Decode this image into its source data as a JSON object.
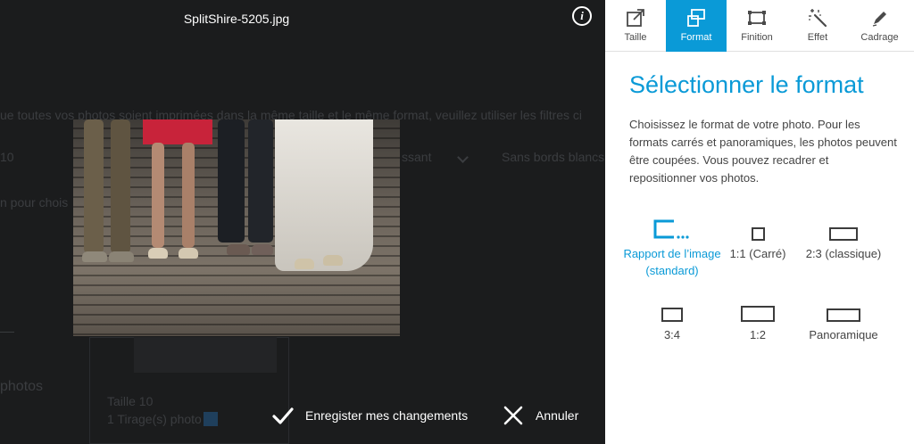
{
  "viewer": {
    "file_name": "SplitShire-5205.jpg",
    "info_label": "i"
  },
  "background": {
    "line1": "ue toutes vos photos soient imprimées dans la même taille et le même format, veuillez utiliser les filtres ci",
    "size_short": "10",
    "select_text": "ssant",
    "border_text": "Sans bords blancs",
    "hint": "n pour chois",
    "section": "photos",
    "card_size": "Taille 10",
    "card_count": "1 Tirage(s) photo"
  },
  "actions": {
    "save_label": "Enregister mes changements",
    "cancel_label": "Annuler"
  },
  "tabs": [
    {
      "label": "Taille",
      "icon": "resize-icon"
    },
    {
      "label": "Format",
      "icon": "format-icon"
    },
    {
      "label": "Finition",
      "icon": "frame-icon"
    },
    {
      "label": "Effet",
      "icon": "magic-wand-icon"
    },
    {
      "label": "Cadrage",
      "icon": "pen-icon"
    }
  ],
  "active_tab": "Format",
  "panel": {
    "title": "Sélectionner le format",
    "description": "Choisissez le format de votre photo. Pour les formats carrés et panoramiques, les photos peuvent être coupées. Vous pouvez recadrer et repositionner vos photos."
  },
  "formats": [
    {
      "label": "Rapport de l’image (standard)",
      "selected": true
    },
    {
      "label": "1:1 (Carré)",
      "selected": false
    },
    {
      "label": "2:3 (classique)",
      "selected": false
    },
    {
      "label": "3:4",
      "selected": false
    },
    {
      "label": "1:2",
      "selected": false
    },
    {
      "label": "Panoramique",
      "selected": false
    }
  ],
  "colors": {
    "accent": "#0a9ad7",
    "overlay": "#161718",
    "panel_bg": "#ffffff"
  }
}
